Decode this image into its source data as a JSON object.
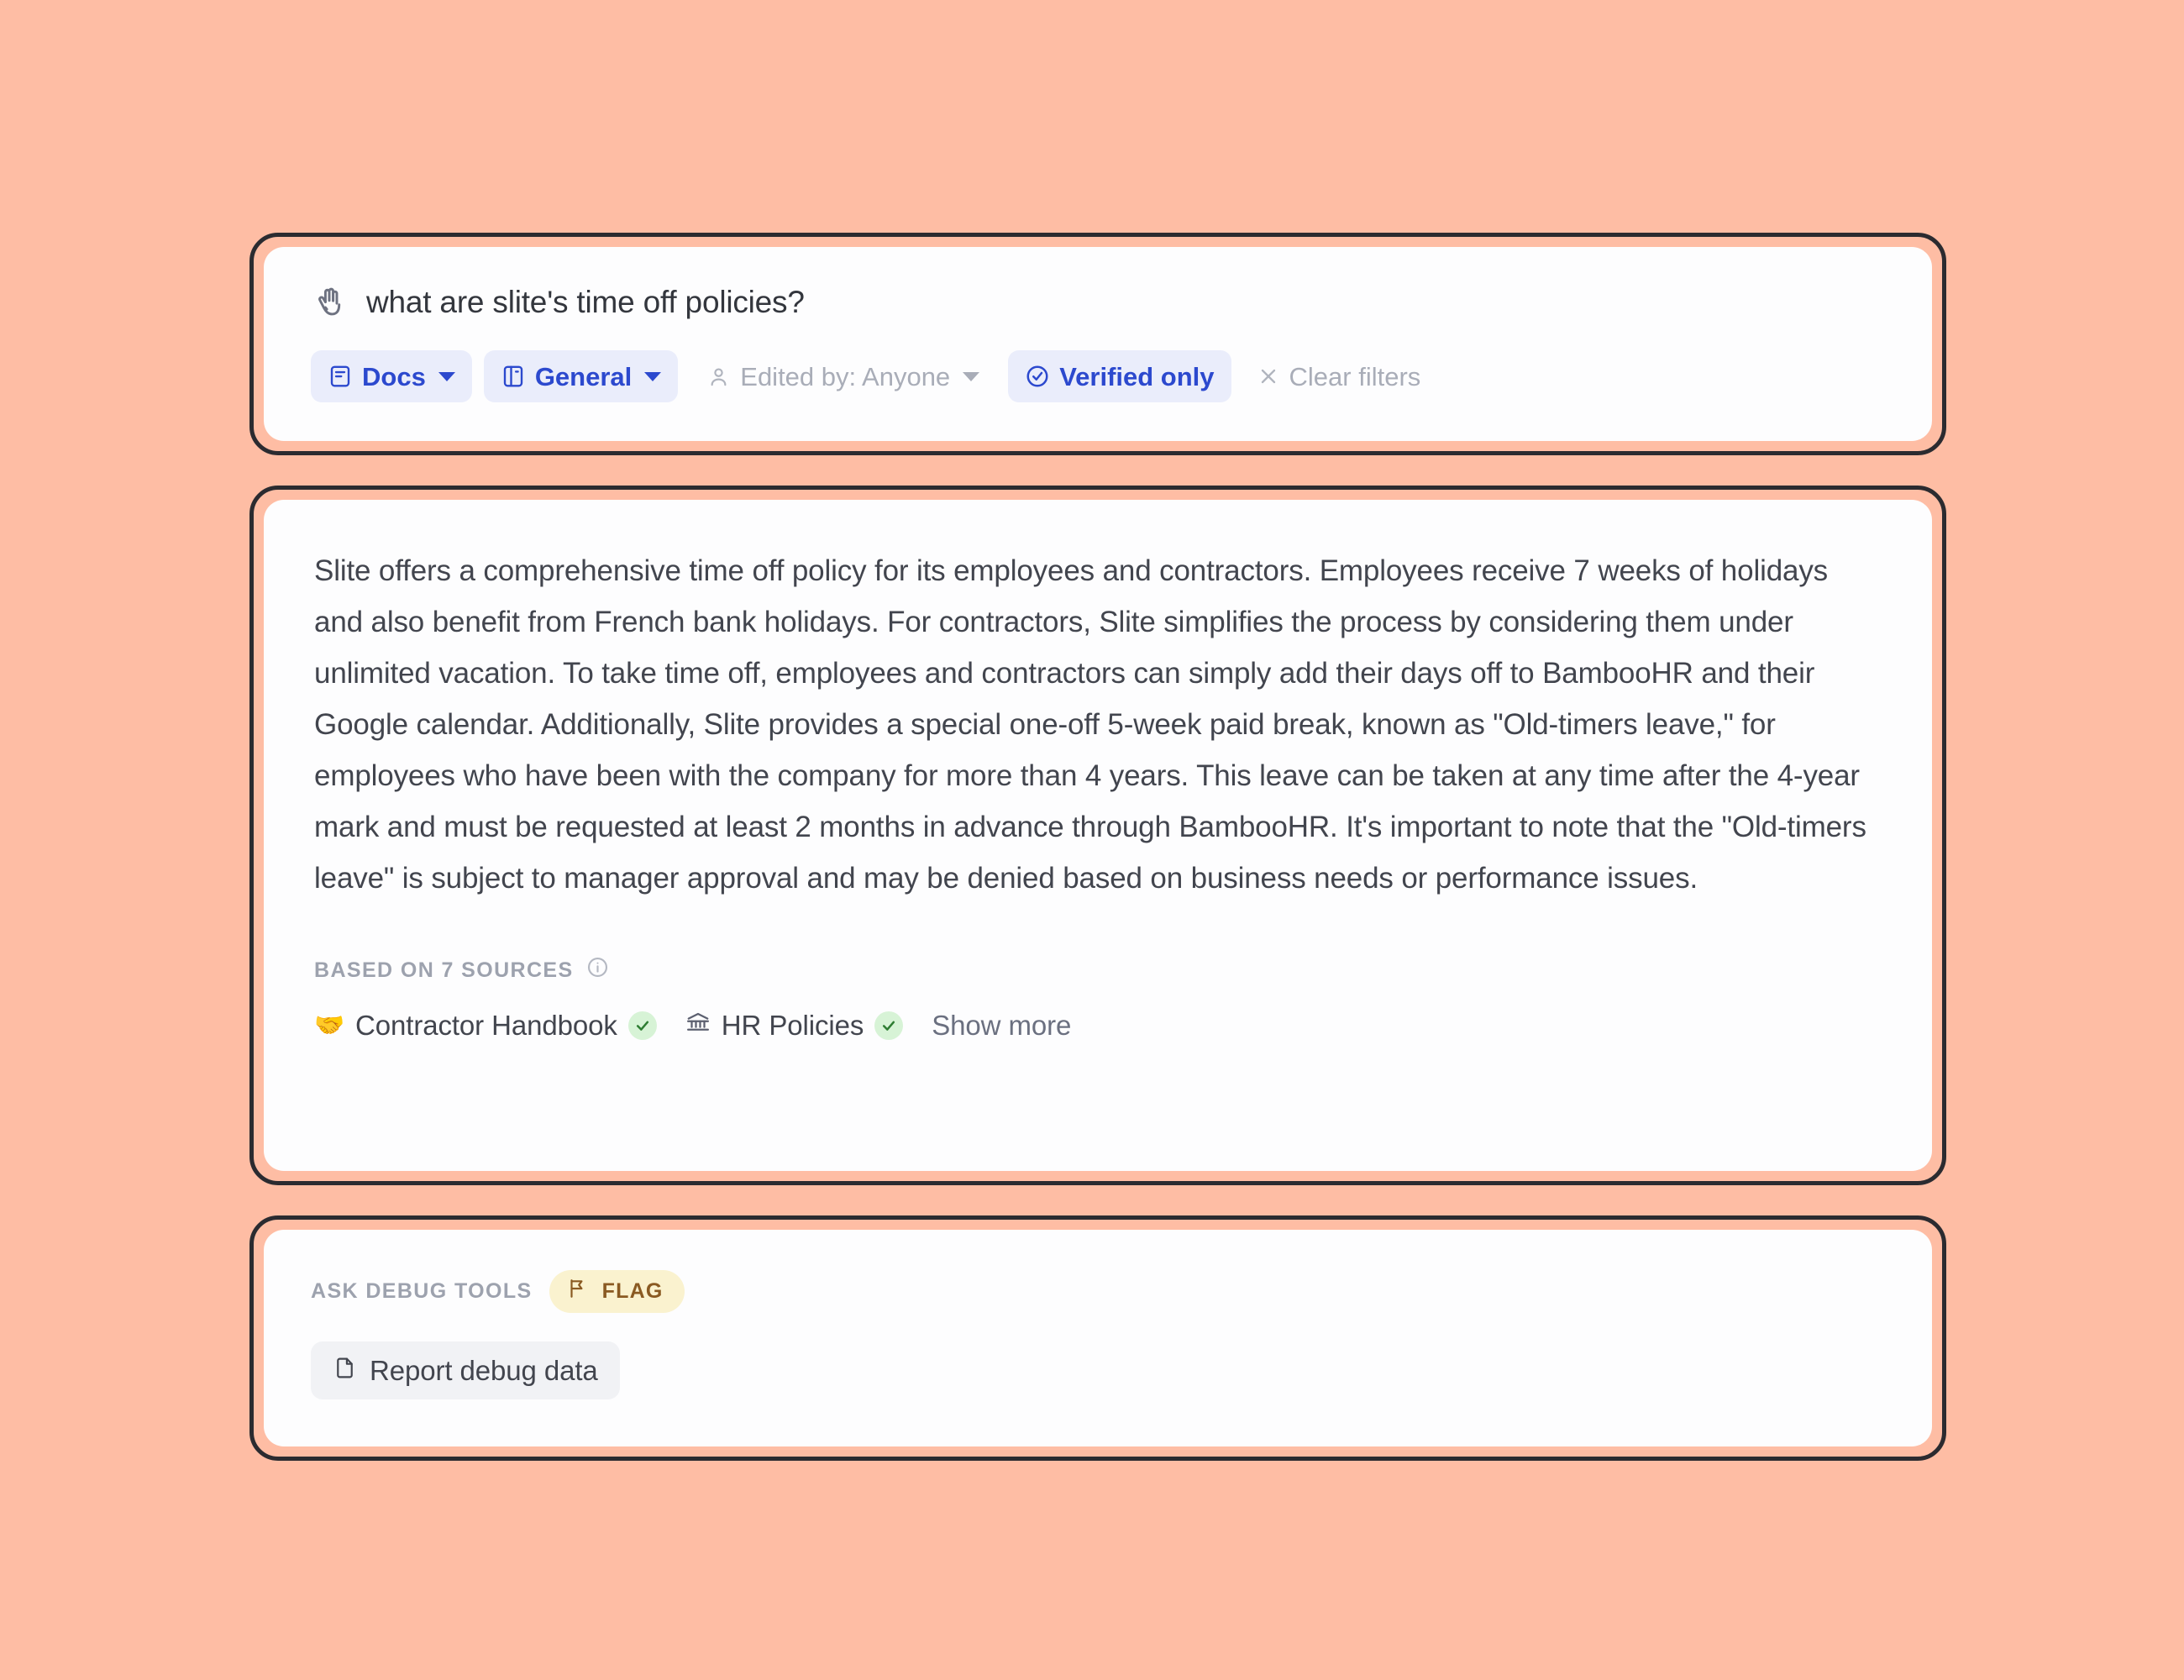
{
  "theme": {
    "page_background": "#FEBDA4",
    "card_border": "#2B2B30",
    "card_fill": "#FDFDFE",
    "accent_blue": "#2C49CE",
    "chip_active_bg": "#EAEDFB",
    "muted_text": "#A9ADB8",
    "body_text": "#42454E",
    "verified_green_bg": "#D7F3D6",
    "flag_badge_bg": "#FAF2CF",
    "flag_badge_text": "#8A5A22"
  },
  "query_card": {
    "icon": "raised-hand-icon",
    "query": "what are slite's time off policies?",
    "filters": [
      {
        "id": "docs",
        "label": "Docs",
        "icon": "document-icon",
        "state": "active",
        "has_caret": true
      },
      {
        "id": "general",
        "label": "General",
        "icon": "panel-icon",
        "state": "active",
        "has_caret": true
      },
      {
        "id": "edited-by",
        "label": "Edited by: Anyone",
        "icon": "person-icon",
        "state": "plain",
        "has_caret": true
      },
      {
        "id": "verified",
        "label": "Verified only",
        "icon": "check-circle-icon",
        "state": "active",
        "has_caret": false
      },
      {
        "id": "clear",
        "label": "Clear filters",
        "icon": "close-icon",
        "state": "plain",
        "has_caret": false
      }
    ]
  },
  "answer_card": {
    "answer": "Slite offers a comprehensive time off policy for its employees and contractors. Employees receive 7 weeks of holidays and also benefit from French bank holidays. For contractors, Slite simplifies the process by considering them under unlimited vacation. To take time off, employees and contractors can simply add their days off to BambooHR and their Google calendar. Additionally, Slite provides a special one-off 5-week paid break, known as \"Old-timers leave,\" for employees who have been with the company for more than 4 years. This leave can be taken at any time after the 4-year mark and must be requested at least 2 months in advance through BambooHR. It's important to note that the \"Old-timers leave\" is subject to manager approval and may be denied based on business needs or performance issues.",
    "sources_label": "BASED ON 7 SOURCES",
    "sources_count": 7,
    "sources": [
      {
        "emoji": "🤝",
        "name": "Contractor Handbook",
        "verified": true
      },
      {
        "icon": "bank-icon",
        "name": "HR Policies",
        "verified": true
      }
    ],
    "show_more_label": "Show more"
  },
  "debug_card": {
    "title": "ASK DEBUG TOOLS",
    "flag_badge": "FLAG",
    "report_button": "Report debug data"
  }
}
